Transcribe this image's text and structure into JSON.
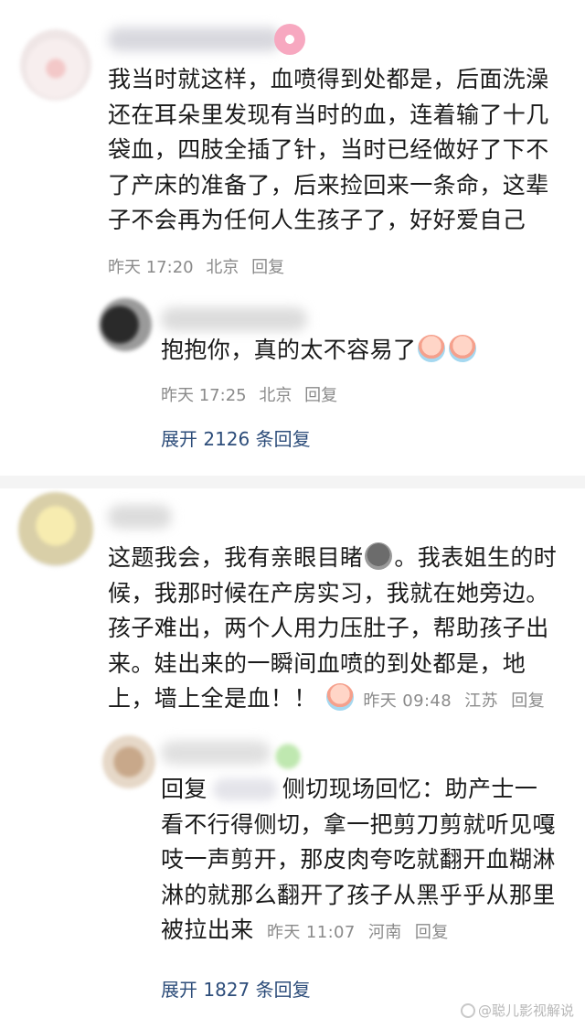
{
  "comments": [
    {
      "text_lines": [
        "我当时就这样，血喷得到处都是，后面洗澡",
        "还在耳朵里发现有当时的血，连着输了十几",
        "袋血，四肢全插了针，当时已经做好了下不",
        "了产床的准备了，后来捡回来一条命，这辈",
        "子不会再为任何人生孩子了，好好爱自己"
      ],
      "time": "昨天 17:20",
      "location": "北京",
      "reply_label": "回复",
      "sub_reply": {
        "text": "抱抱你，真的太不容易了",
        "emoji": [
          "crying-face-emoji",
          "crying-face-emoji"
        ],
        "time": "昨天 17:25",
        "location": "北京",
        "reply_label": "回复"
      },
      "expand": {
        "prefix": "展开",
        "count": "2126",
        "suffix": "条回复"
      }
    },
    {
      "text_lines": [
        "这题我会，我有亲眼目睹",
        "。我表姐生的时",
        "候，我那时候在产房实习，我就在她旁边。",
        "孩子难出，两个人用力压肚子，帮助孩子出",
        "来。娃出来的一瞬间血喷的到处都是，地",
        "上，墙上全是血！！"
      ],
      "time": "昨天 09:48",
      "location": "江苏",
      "reply_label": "回复",
      "sub_reply": {
        "prefix": "回复",
        "first_line": "侧切现场回忆：助产士一",
        "lines": [
          "看不行得侧切，拿一把剪刀剪就听见嘎",
          "吱一声剪开，那皮肉夸吃就翻开血糊淋",
          "淋的就那么翻开了孩子从黑乎乎从那里",
          "被拉出来"
        ],
        "time": "昨天 11:07",
        "location": "河南",
        "reply_label": "回复"
      },
      "expand": {
        "prefix": "展开",
        "count": "1827",
        "suffix": "条回复"
      }
    }
  ],
  "watermark": "@聪儿影视解说"
}
